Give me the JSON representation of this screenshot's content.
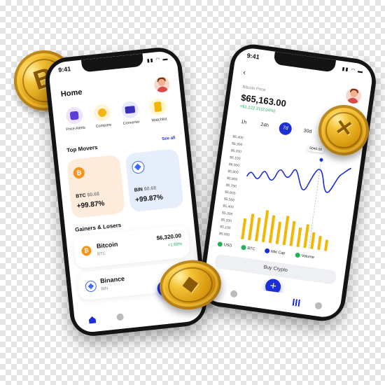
{
  "left_phone": {
    "status_time": "9:41",
    "title": "Home",
    "tools": [
      {
        "label": "Price Alerts",
        "icon": "bell-icon"
      },
      {
        "label": "Compare",
        "icon": "compare-icon"
      },
      {
        "label": "Converter",
        "icon": "converter-icon"
      },
      {
        "label": "Watchlist",
        "icon": "watchlist-icon"
      }
    ],
    "top_movers_title": "Top Movers",
    "see_all": "See all",
    "movers": [
      {
        "symbol": "BTC",
        "price": "$0.68",
        "change": "+99.87%",
        "color": "#f7931a"
      },
      {
        "symbol": "BIN",
        "price": "$0.68",
        "change": "+99.87%",
        "color": "#3b6cff"
      }
    ],
    "gainers_title": "Gainers & Losers",
    "gainers": [
      {
        "name": "Bitcoin",
        "symbol": "BTC",
        "price": "$6,320.00",
        "change": "+1.68%"
      },
      {
        "name": "Binance",
        "symbol": "BIN",
        "price": "",
        "change": ""
      }
    ]
  },
  "right_phone": {
    "status_time": "9:41",
    "price_label": "Bitcoin Price",
    "price": "$65,163.00",
    "price_change": "+$1,122.21(2.04%)",
    "ranges": [
      "1h",
      "24h",
      "7d",
      "30d"
    ],
    "active_range": "7d",
    "y_labels": [
      "$6,400",
      "$6,300",
      "$6,200",
      "$6,100",
      "$6,000",
      "$5,900",
      "$5,800",
      "$5,700",
      "$5,600",
      "$5,500",
      "$5,400",
      "$5,300",
      "$5,200",
      "$5,100",
      "$5,000"
    ],
    "tooltip": "5040.00",
    "legend": [
      {
        "label": "USD",
        "color": "#22b35a"
      },
      {
        "label": "BTC",
        "color": "#22b35a"
      },
      {
        "label": "Mkt Cap",
        "color": "#1c2fd6"
      },
      {
        "label": "Volume",
        "color": "#22b35a"
      }
    ],
    "buy_button": "Buy Crypto"
  },
  "accent": "#1c2fd6",
  "positive": "#22b35a"
}
